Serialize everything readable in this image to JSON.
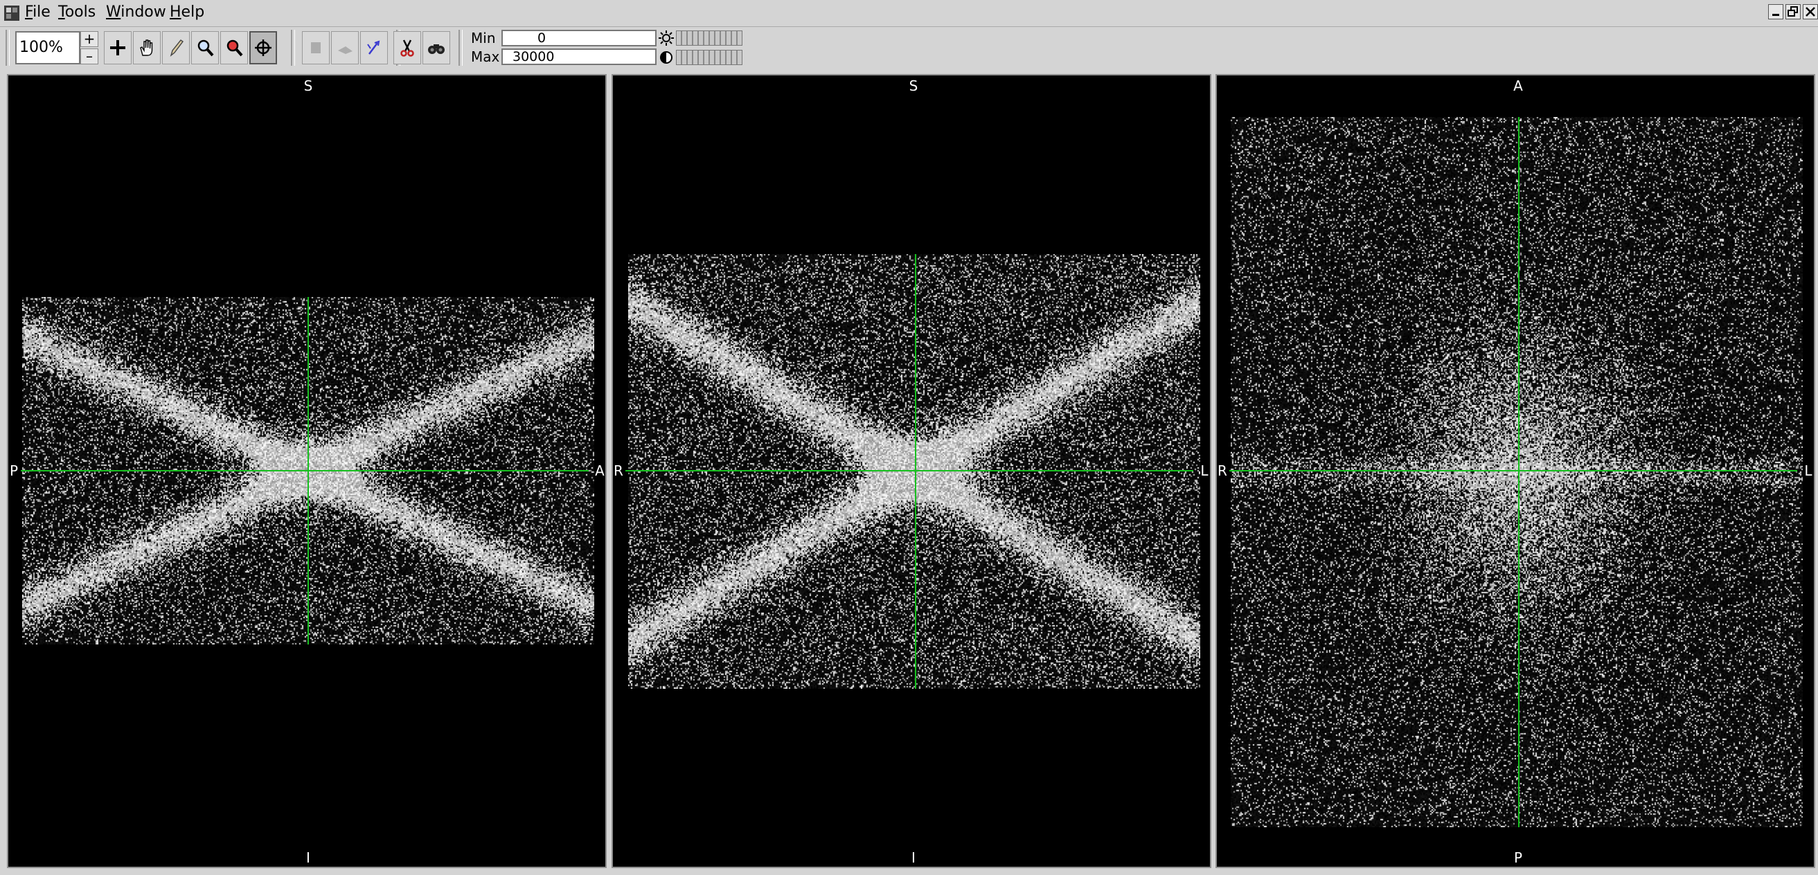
{
  "menu": {
    "items": [
      {
        "label": "File",
        "mnemonic": "F",
        "rest": "ile"
      },
      {
        "label": "Tools",
        "mnemonic": "T",
        "rest": "ools"
      },
      {
        "label": "Window",
        "mnemonic": "W",
        "rest": "indow"
      },
      {
        "label": "Help",
        "mnemonic": "H",
        "rest": "elp"
      }
    ]
  },
  "toolbar": {
    "zoom": "100%",
    "zoom_plus": "+",
    "zoom_minus": "–",
    "min_label": "Min",
    "min_value": "0",
    "max_label": "Max",
    "max_value": "30000",
    "tools": [
      "crosshair-add-icon",
      "pan-hand-icon",
      "pencil-icon",
      "magnifier-icon",
      "zoom-region-icon",
      "navigate-target-icon",
      "stamp-icon",
      "arrow-icon",
      "vector-icon",
      "scissors-icon",
      "binoculars-icon"
    ]
  },
  "views": [
    {
      "id": "sagittal",
      "top": "S",
      "bottom": "I",
      "left": "P",
      "right": "A"
    },
    {
      "id": "coronal",
      "top": "S",
      "bottom": "I",
      "left": "R",
      "right": "L"
    },
    {
      "id": "axial",
      "top": "A",
      "bottom": "P",
      "left": "R",
      "right": "L"
    }
  ],
  "colors": {
    "crosshair": "#16c01e",
    "panel_bg": "#000000",
    "chrome": "#d4d4d4"
  }
}
